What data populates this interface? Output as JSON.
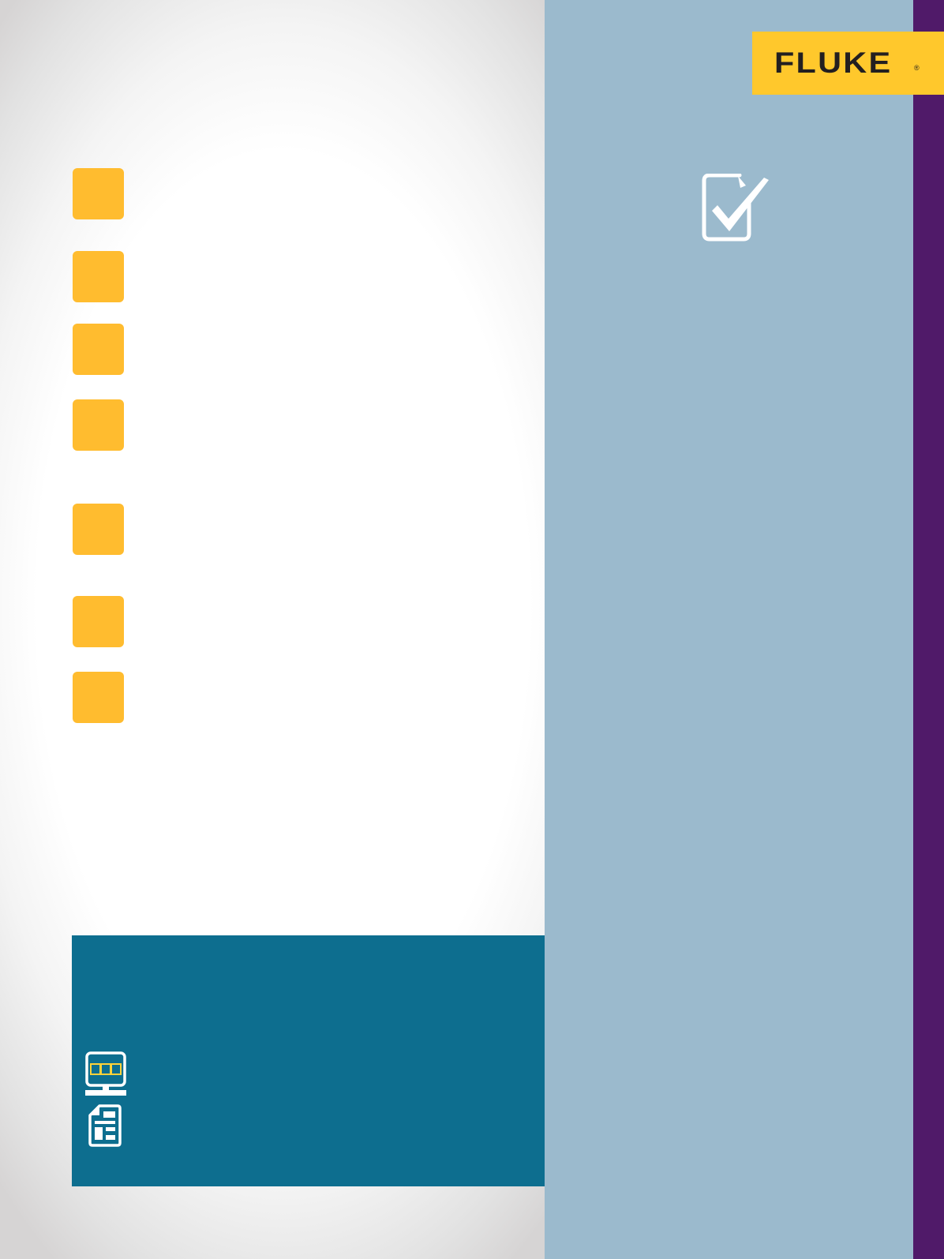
{
  "logo": {
    "text": "FLUKE",
    "registered": "®"
  },
  "icons": {
    "clipboard": "clipboard-check-icon",
    "monitor": "monitor-video-icon",
    "document": "document-layout-icon"
  },
  "bullets": [
    {
      "name": "bullet-1"
    },
    {
      "name": "bullet-2"
    },
    {
      "name": "bullet-3"
    },
    {
      "name": "bullet-4"
    },
    {
      "name": "bullet-5"
    },
    {
      "name": "bullet-6"
    },
    {
      "name": "bullet-7"
    }
  ],
  "colors": {
    "brand_yellow": "#ffc82c",
    "bullet_orange": "#ffbc2f",
    "panel_blue": "#9bbacd",
    "box_teal": "#0d6e8f",
    "strip_purple": "#501a69",
    "logo_text": "#231f20"
  }
}
